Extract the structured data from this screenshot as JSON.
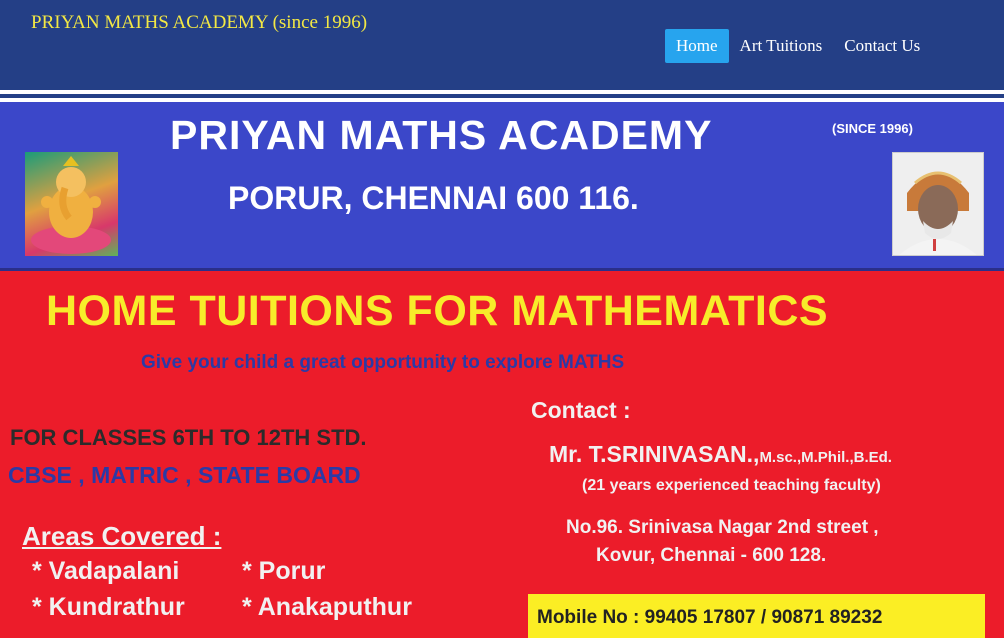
{
  "header": {
    "site_title": "PRIYAN MATHS ACADEMY (since 1996)",
    "nav": [
      {
        "label": "Home",
        "active": true
      },
      {
        "label": "Art Tuitions",
        "active": false
      },
      {
        "label": "Contact Us",
        "active": false
      }
    ]
  },
  "banner": {
    "title": "PRIYAN MATHS ACADEMY",
    "since": "(SINCE 1996)",
    "subtitle": "PORUR, CHENNAI 600 116."
  },
  "main": {
    "headline": "HOME TUITIONS FOR MATHEMATICS",
    "tagline": "Give your child a great opportunity to explore MATHS",
    "classes": "FOR CLASSES 6TH TO 12TH STD.",
    "boards": "CBSE , MATRIC , STATE BOARD",
    "areas_heading": "Areas Covered :",
    "areas": [
      "* Vadapalani",
      "* Porur",
      "* Kundrathur",
      "* Anakaputhur"
    ]
  },
  "contact": {
    "label": "Contact :",
    "name": "Mr. T.SRINIVASAN.,",
    "qualifications": "M.sc.,M.Phil.,B.Ed.",
    "experience": "(21 years experienced teaching faculty)",
    "address_line1": "No.96. Srinivasa Nagar 2nd street ,",
    "address_line2": "Kovur,  Chennai - 600 128.",
    "mobile": "Mobile No : 99405 17807 / 90871 89232"
  },
  "colors": {
    "header_bg": "#243f86",
    "banner_bg": "#3b47c9",
    "main_bg": "#ec1c2a",
    "accent_yellow": "#f7ec2a",
    "nav_active": "#27a4ee"
  }
}
